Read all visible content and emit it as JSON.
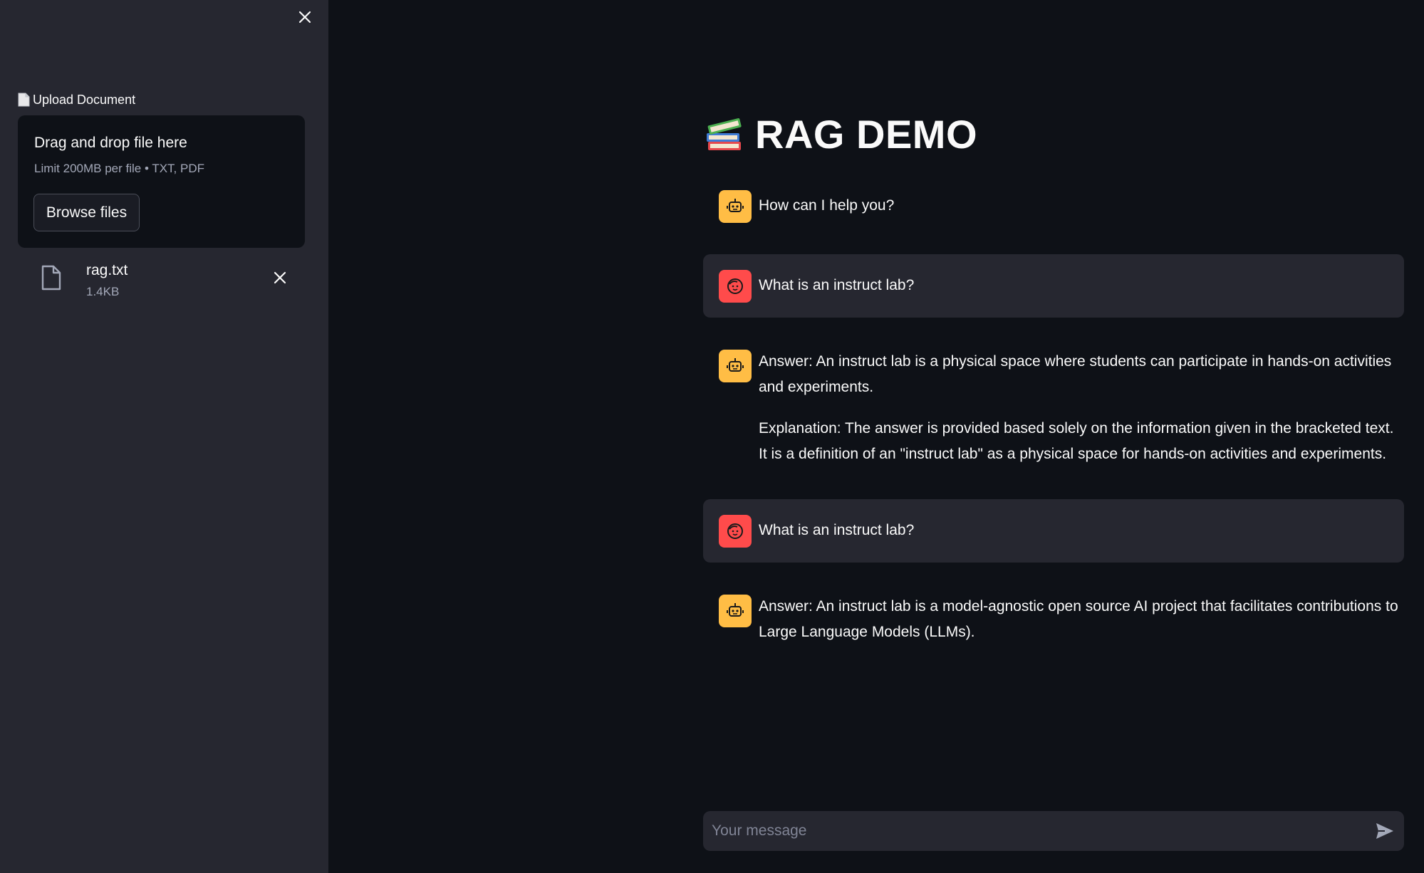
{
  "sidebar": {
    "close_icon": "close-icon",
    "upload_label": "Upload Document",
    "dropzone": {
      "title": "Drag and drop file here",
      "subtitle": "Limit 200MB per file • TXT, PDF",
      "browse_label": "Browse files"
    },
    "file": {
      "name": "rag.txt",
      "size": "1.4KB"
    }
  },
  "main": {
    "title_emoji": "📚",
    "title": "RAG DEMO",
    "messages": [
      {
        "role": "assistant",
        "paragraphs": [
          "How can I help you?"
        ]
      },
      {
        "role": "user",
        "paragraphs": [
          "What is an instruct lab?"
        ]
      },
      {
        "role": "assistant",
        "paragraphs": [
          "Answer: An instruct lab is a physical space where students can participate in hands-on activities and experiments.",
          "Explanation: The answer is provided based solely on the information given in the bracketed text. It is a definition of an \"instruct lab\" as a physical space for hands-on activities and experiments."
        ]
      },
      {
        "role": "user",
        "paragraphs": [
          "What is an instruct lab?"
        ]
      },
      {
        "role": "assistant",
        "paragraphs": [
          "Answer: An instruct lab is a model-agnostic open source AI project that facilitates contributions to Large Language Models (LLMs)."
        ]
      }
    ],
    "chat_input": {
      "placeholder": "Your message",
      "value": ""
    }
  },
  "colors": {
    "background": "#0e1117",
    "sidebar": "#262730",
    "assistant_avatar": "#ffbd45",
    "user_avatar": "#ff4b4b"
  }
}
